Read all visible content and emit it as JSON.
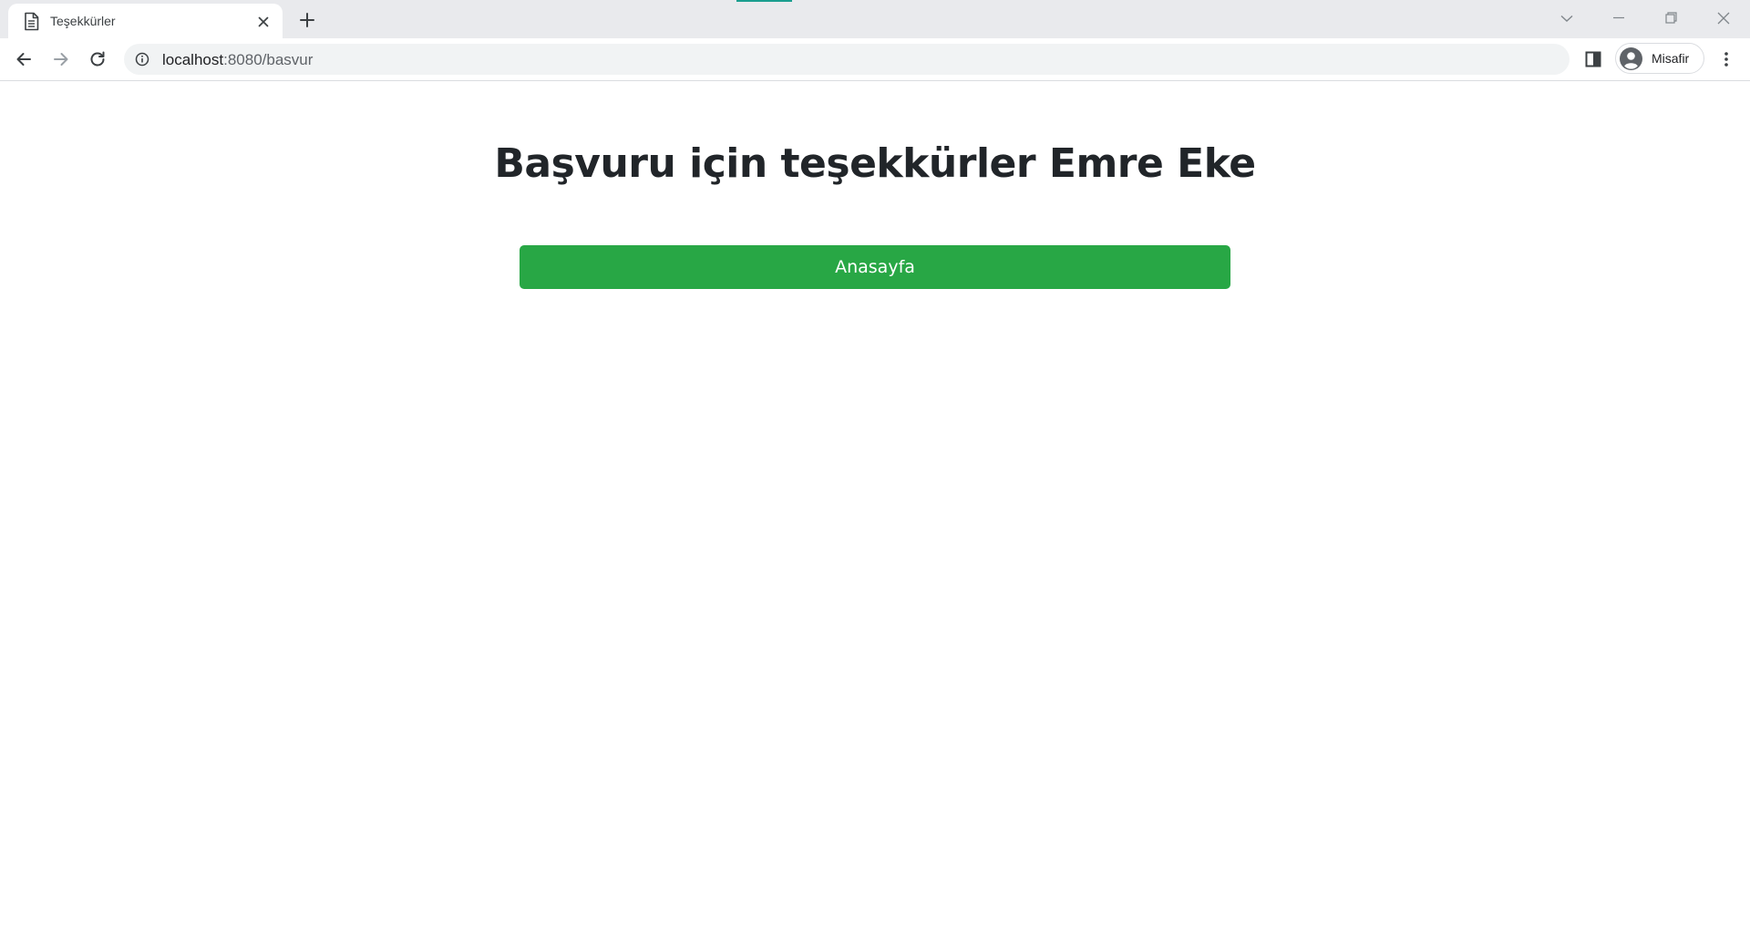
{
  "browser": {
    "tab": {
      "title": "Teşekkürler"
    },
    "address_bar": {
      "host": "localhost",
      "rest": ":8080/basvur"
    },
    "profile": {
      "label": "Misafir"
    },
    "accent_color": "#1a9e8f"
  },
  "page": {
    "heading": "Başvuru için teşekkürler Emre Eke",
    "home_button": {
      "label": "Anasayfa",
      "color": "#28a745"
    }
  }
}
